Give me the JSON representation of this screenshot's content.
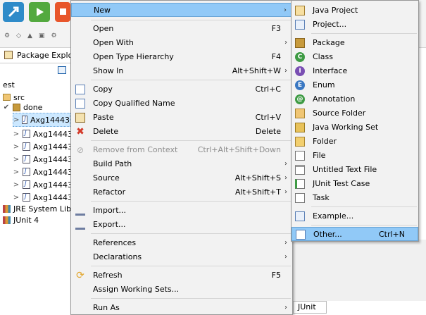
{
  "window": {
    "explorer_title": "Package Explo...",
    "bottom_tab": "JUnit"
  },
  "tree": [
    {
      "label": "est",
      "caret": ""
    },
    {
      "label": "src",
      "caret": ""
    },
    {
      "label": "done",
      "caret": "✔"
    },
    {
      "label": "Axg14443",
      "caret": ">"
    },
    {
      "label": "Axg14443",
      "caret": ">"
    },
    {
      "label": "Axg14443",
      "caret": ">"
    },
    {
      "label": "Axg14443",
      "caret": ">"
    },
    {
      "label": "Axg14443",
      "caret": ">"
    },
    {
      "label": "Axg14443",
      "caret": ">"
    },
    {
      "label": "Axg14443",
      "caret": ">"
    },
    {
      "label": "JRE System Libra",
      "caret": ""
    },
    {
      "label": "JUnit 4",
      "caret": ""
    }
  ],
  "menu": {
    "new": {
      "label": "New"
    },
    "open": {
      "label": "Open",
      "shortcut": "F3"
    },
    "open_with": {
      "label": "Open With"
    },
    "open_type_hierarchy": {
      "label": "Open Type Hierarchy",
      "shortcut": "F4"
    },
    "show_in": {
      "label": "Show In",
      "shortcut": "Alt+Shift+W"
    },
    "copy": {
      "label": "Copy",
      "shortcut": "Ctrl+C"
    },
    "copy_qualified_name": {
      "label": "Copy Qualified Name"
    },
    "paste": {
      "label": "Paste",
      "shortcut": "Ctrl+V"
    },
    "delete": {
      "label": "Delete",
      "shortcut": "Delete"
    },
    "remove_from_context": {
      "label": "Remove from Context",
      "shortcut": "Ctrl+Alt+Shift+Down"
    },
    "build_path": {
      "label": "Build Path"
    },
    "source": {
      "label": "Source",
      "shortcut": "Alt+Shift+S"
    },
    "refactor": {
      "label": "Refactor",
      "shortcut": "Alt+Shift+T"
    },
    "import": {
      "label": "Import..."
    },
    "export": {
      "label": "Export..."
    },
    "references": {
      "label": "References"
    },
    "declarations": {
      "label": "Declarations"
    },
    "refresh": {
      "label": "Refresh",
      "shortcut": "F5"
    },
    "assign_working_sets": {
      "label": "Assign Working Sets..."
    },
    "run_as": {
      "label": "Run As"
    }
  },
  "submenu": {
    "java_project": "Java Project",
    "project": "Project...",
    "package": "Package",
    "class": "Class",
    "interface": "Interface",
    "enum": "Enum",
    "annotation": "Annotation",
    "source_folder": "Source Folder",
    "java_working_set": "Java Working Set",
    "folder": "Folder",
    "file": "File",
    "untitled_text_file": "Untitled Text File",
    "junit_test_case": "JUnit Test Case",
    "task": "Task",
    "example": "Example...",
    "other": {
      "label": "Other...",
      "shortcut": "Ctrl+N"
    }
  },
  "icons": {
    "accent_highlight": "#91c9f7",
    "run_button": "#53a93f",
    "debug_button": "#2e8bc9"
  }
}
